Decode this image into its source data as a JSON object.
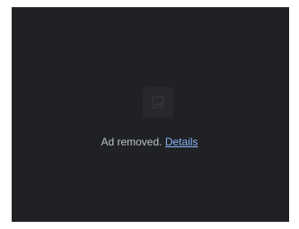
{
  "ad_notice": {
    "message": "Ad removed.",
    "details_link": "Details",
    "icon": "image-placeholder-icon",
    "colors": {
      "background": "#202124",
      "text": "#bdc1c6",
      "link": "#8ab4f8"
    }
  }
}
